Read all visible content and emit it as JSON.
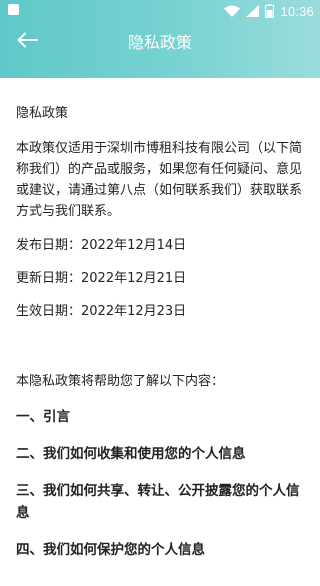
{
  "status_bar": {
    "time": "10:36",
    "icons": [
      "app-icon",
      "wifi-icon",
      "signal-icon",
      "battery-icon"
    ]
  },
  "header": {
    "back_icon": "arrow-left-icon",
    "title": "隐私政策",
    "colors": {
      "gradient_start": "#5fc8c8",
      "gradient_end": "#9adcdc",
      "text": "#ffffff"
    }
  },
  "document": {
    "heading": "隐私政策",
    "intro": "本政策仅适用于深圳市博租科技有限公司（以下简称我们）的产品或服务，如果您有任何疑问、意见或建议，请通过第八点（如何联系我们）获取联系方式与我们联系。",
    "dates": [
      {
        "label": "发布日期：",
        "value": "2022年12月14日"
      },
      {
        "label": "更新日期：",
        "value": "2022年12月21日"
      },
      {
        "label": "生效日期：",
        "value": "2022年12月23日"
      }
    ],
    "toc_intro": "本隐私政策将帮助您了解以下内容：",
    "sections": [
      "一、引言",
      "二、我们如何收集和使用您的个人信息",
      "三、我们如何共享、转让、公开披露您的个人信息",
      "四、我们如何保护您的个人信息"
    ]
  }
}
